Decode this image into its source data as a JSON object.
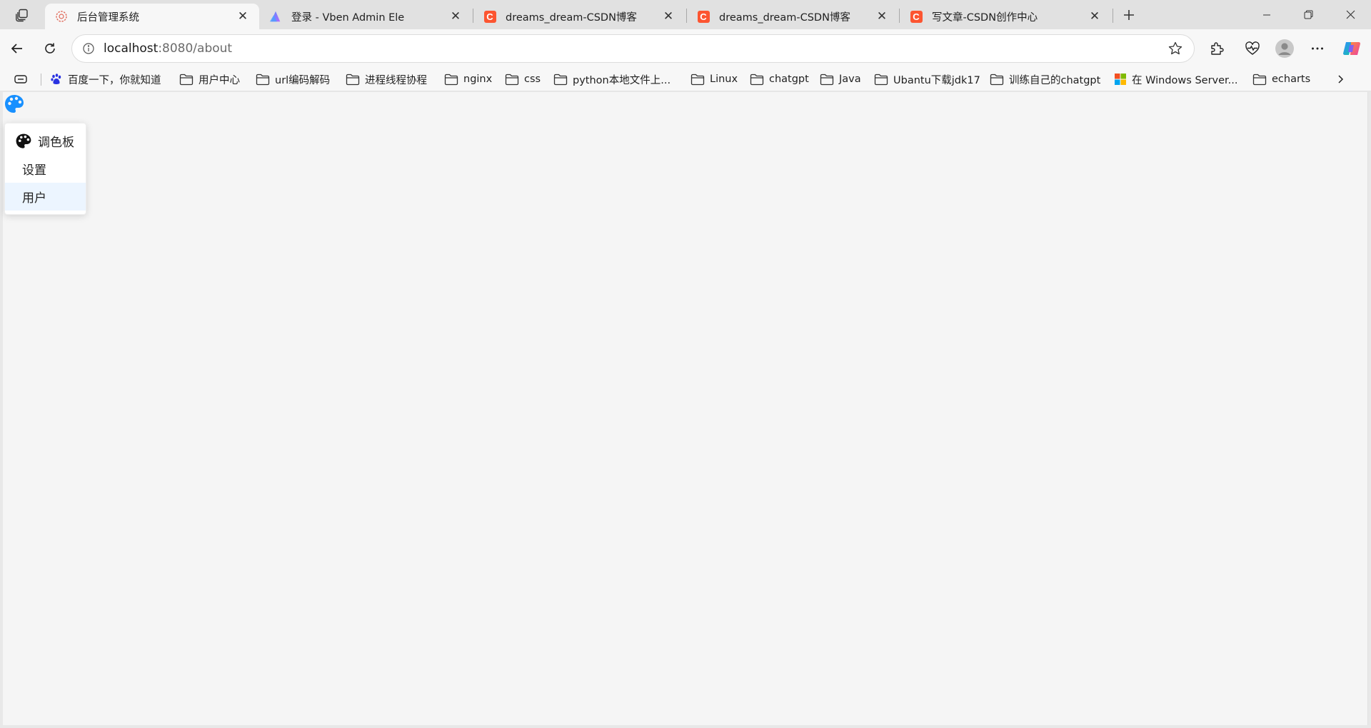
{
  "browser": {
    "tabs": [
      {
        "title": "后台管理系统",
        "active": true,
        "favicon": "vue-logo-icon"
      },
      {
        "title": "登录 - Vben Admin Ele",
        "active": false,
        "favicon": "vben-logo-icon"
      },
      {
        "title": "dreams_dream-CSDN博客",
        "active": false,
        "favicon": "csdn-icon"
      },
      {
        "title": "dreams_dream-CSDN博客",
        "active": false,
        "favicon": "csdn-icon"
      },
      {
        "title": "写文章-CSDN创作中心",
        "active": false,
        "favicon": "csdn-icon"
      }
    ],
    "address": {
      "host": "localhost",
      "path": ":8080/about"
    },
    "csdn_letter": "C",
    "bookmarks": [
      {
        "label": "百度一下，你就知道",
        "icon": "baidu-paw-icon"
      },
      {
        "label": "用户中心",
        "icon": "folder-icon"
      },
      {
        "label": "url编码解码",
        "icon": "folder-icon"
      },
      {
        "label": "进程线程协程",
        "icon": "folder-icon"
      },
      {
        "label": "nginx",
        "icon": "folder-icon"
      },
      {
        "label": "css",
        "icon": "folder-icon"
      },
      {
        "label": "python本地文件上...",
        "icon": "folder-icon"
      },
      {
        "label": "Linux",
        "icon": "folder-icon"
      },
      {
        "label": "chatgpt",
        "icon": "folder-icon"
      },
      {
        "label": "Java",
        "icon": "folder-icon"
      },
      {
        "label": "Ubantu下载jdk17",
        "icon": "folder-icon"
      },
      {
        "label": "训练自己的chatgpt",
        "icon": "folder-icon"
      },
      {
        "label": "在 Windows Server...",
        "icon": "windows-logo-icon"
      },
      {
        "label": "echarts",
        "icon": "folder-icon"
      }
    ]
  },
  "app": {
    "trigger_icon": "palette-icon",
    "accent": "#409eff",
    "menu": [
      {
        "label": "调色板",
        "icon": "palette-icon",
        "hovered": false
      },
      {
        "label": "设置",
        "icon": "",
        "hovered": false
      },
      {
        "label": "用户",
        "icon": "",
        "hovered": true
      }
    ]
  }
}
